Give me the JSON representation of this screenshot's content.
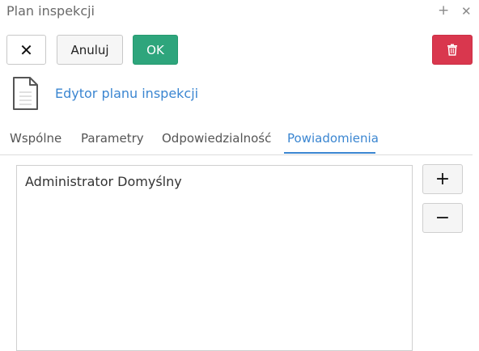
{
  "window": {
    "title": "Plan inspekcji",
    "plus_icon": "plus-icon",
    "close_icon": "close-icon"
  },
  "toolbar": {
    "close_icon": "close-icon",
    "cancel_label": "Anuluj",
    "ok_label": "OK",
    "delete_icon": "trash-icon",
    "ok_color": "#2ea57c",
    "delete_color": "#d9374e"
  },
  "editor": {
    "icon": "document-icon",
    "link_text": "Edytor planu inspekcji",
    "link_color": "#3b86d1"
  },
  "tabs": [
    {
      "label": "Wspólne"
    },
    {
      "label": "Parametry"
    },
    {
      "label": "Odpowiedzialność"
    },
    {
      "label": "Powiadomienia",
      "active": true
    }
  ],
  "list": {
    "items": [
      "Administrator Domyślny"
    ]
  },
  "side_buttons": {
    "add": "+",
    "remove": "−"
  }
}
